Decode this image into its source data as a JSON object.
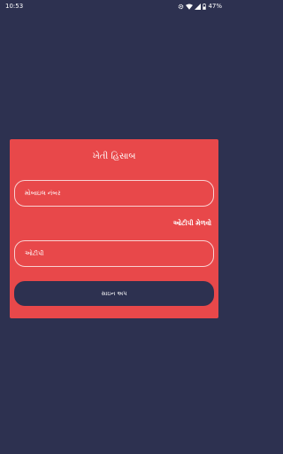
{
  "status_bar": {
    "time": "10:53",
    "battery_percent": "47%",
    "icons": [
      "settings-gear-icon",
      "wifi-icon",
      "signal-icon",
      "battery-icon"
    ]
  },
  "form": {
    "title": "ખેતી હિસાબ",
    "mobile_placeholder": "મોબાઇલ નંબર",
    "get_otp_link": "ઓટીપી મેળવો",
    "otp_placeholder": "ઓટીપી",
    "signup_button": "સાઇન અપ"
  },
  "colors": {
    "background": "#2d3150",
    "card": "#e8484a",
    "button": "#2d3150",
    "text": "#ffffff"
  }
}
